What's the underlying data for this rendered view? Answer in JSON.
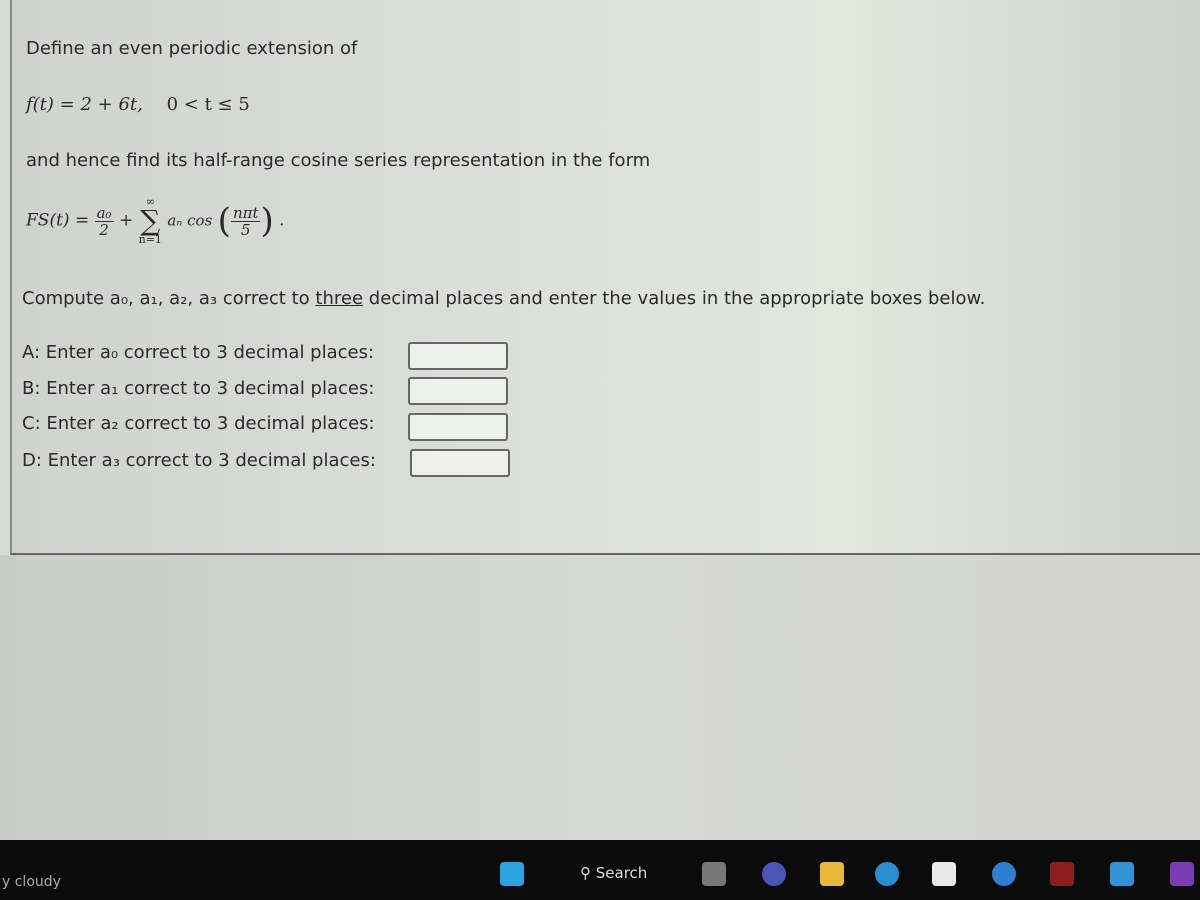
{
  "question": {
    "intro": "Define an even periodic extension of",
    "function": {
      "lhs": "f(t) = 2 + 6t,",
      "domain": "0 < t ≤ 5"
    },
    "instruction": "and hence find its half-range cosine series representation in the form",
    "formula": {
      "lhs": "FS(t) =",
      "a0": "a₀",
      "two": "2",
      "plus": "+",
      "sum_top": "∞",
      "sigma": "∑",
      "sum_bottom": "n=1",
      "term": "aₙ cos",
      "arg_num": "nπt",
      "arg_den": "5",
      "end": "."
    },
    "compute_pre": "Compute a₀, a₁, a₂, a₃ correct to",
    "compute_underlined": "three",
    "compute_post": "decimal places and enter the values in the appropriate boxes below."
  },
  "answers": [
    {
      "label": "A: Enter a₀ correct to 3 decimal places:",
      "value": ""
    },
    {
      "label": "B: Enter a₁ correct to 3 decimal places:",
      "value": ""
    },
    {
      "label": "C: Enter a₂ correct to 3 decimal places:",
      "value": ""
    },
    {
      "label": "D: Enter a₃ correct to 3 decimal places:",
      "value": ""
    }
  ],
  "taskbar": {
    "weather": "y cloudy",
    "search_label": "Search",
    "icons": [
      "windows-start-icon",
      "task-view-icon",
      "meet-icon",
      "file-explorer-icon",
      "edge-icon",
      "store-icon",
      "help-icon",
      "mcafee-icon",
      "mail-icon",
      "onenote-icon"
    ]
  }
}
